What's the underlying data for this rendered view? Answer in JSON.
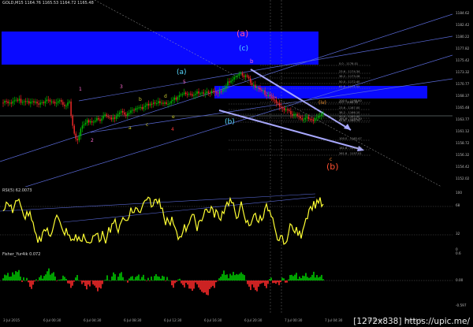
{
  "window": {
    "main_title": "GOLD,M15  1164.76  1165.53  1164.72  1165.48",
    "rsi_title": "RSI(5) 62.0073",
    "fisher_title": "Fisher_Yur4ik 0.072"
  },
  "price_axis": [
    "1184.62",
    "1182.42",
    "1180.22",
    "1177.82",
    "1175.42",
    "1173.32",
    "1170.77",
    "1168.37",
    "1165.48",
    "1163.77",
    "1161.12",
    "1158.72",
    "1156.32",
    "1154.42",
    "1152.02"
  ],
  "rsi_axis": [
    "100",
    "68",
    "32",
    "0"
  ],
  "fisher_axis": [
    "0.6",
    "0.00",
    "-0.597"
  ],
  "time_axis": [
    "3 Jul 2015",
    "6 Jul 00:30",
    "6 Jul 04:30",
    "6 Jul 08:30",
    "6 Jul 12:30",
    "6 Jul 16:30",
    "6 Jul 20:30",
    "7 Jul 00:30",
    "7 Jul 04:30",
    "7 Jul 08:30",
    "7 Jul 12:30"
  ],
  "wave_labels": {
    "a_blue": "(a)",
    "b_blue": "(b)",
    "c_blue": "(c)",
    "a_pink": "(a)",
    "b_red": "(b)",
    "iv_orange": "(iv)",
    "small_b": "b",
    "small_c": "c",
    "small_a": "a"
  },
  "fib_labels": [
    "0.0 - 1176.01",
    "23.6 - 1174.34",
    "38.2 - 1173.28",
    "50.0 - 1172.40",
    "61.8 - 1171.52",
    "100.0 - 1168.80",
    "161.8 - 1164.30",
    "261.8 - 1157.01",
    "0.0 - 1168.40",
    "23.6 - 1167.00",
    "38.2 - 1166.10",
    "50.0 - 1165.40",
    "61.8 - 1164.70",
    "100.0 - 1162.47",
    "161.8 - 1158.80"
  ],
  "watermark": "[1272x838] https://upic.me/",
  "colors": {
    "background": "#000000",
    "zone": "#0a0aff",
    "bull_candle": "#00c800",
    "bear_candle": "#ff2a2a",
    "rsi_line": "#ffff33",
    "channel": "#5a6ad8",
    "projection": "#a8a8ff"
  }
}
